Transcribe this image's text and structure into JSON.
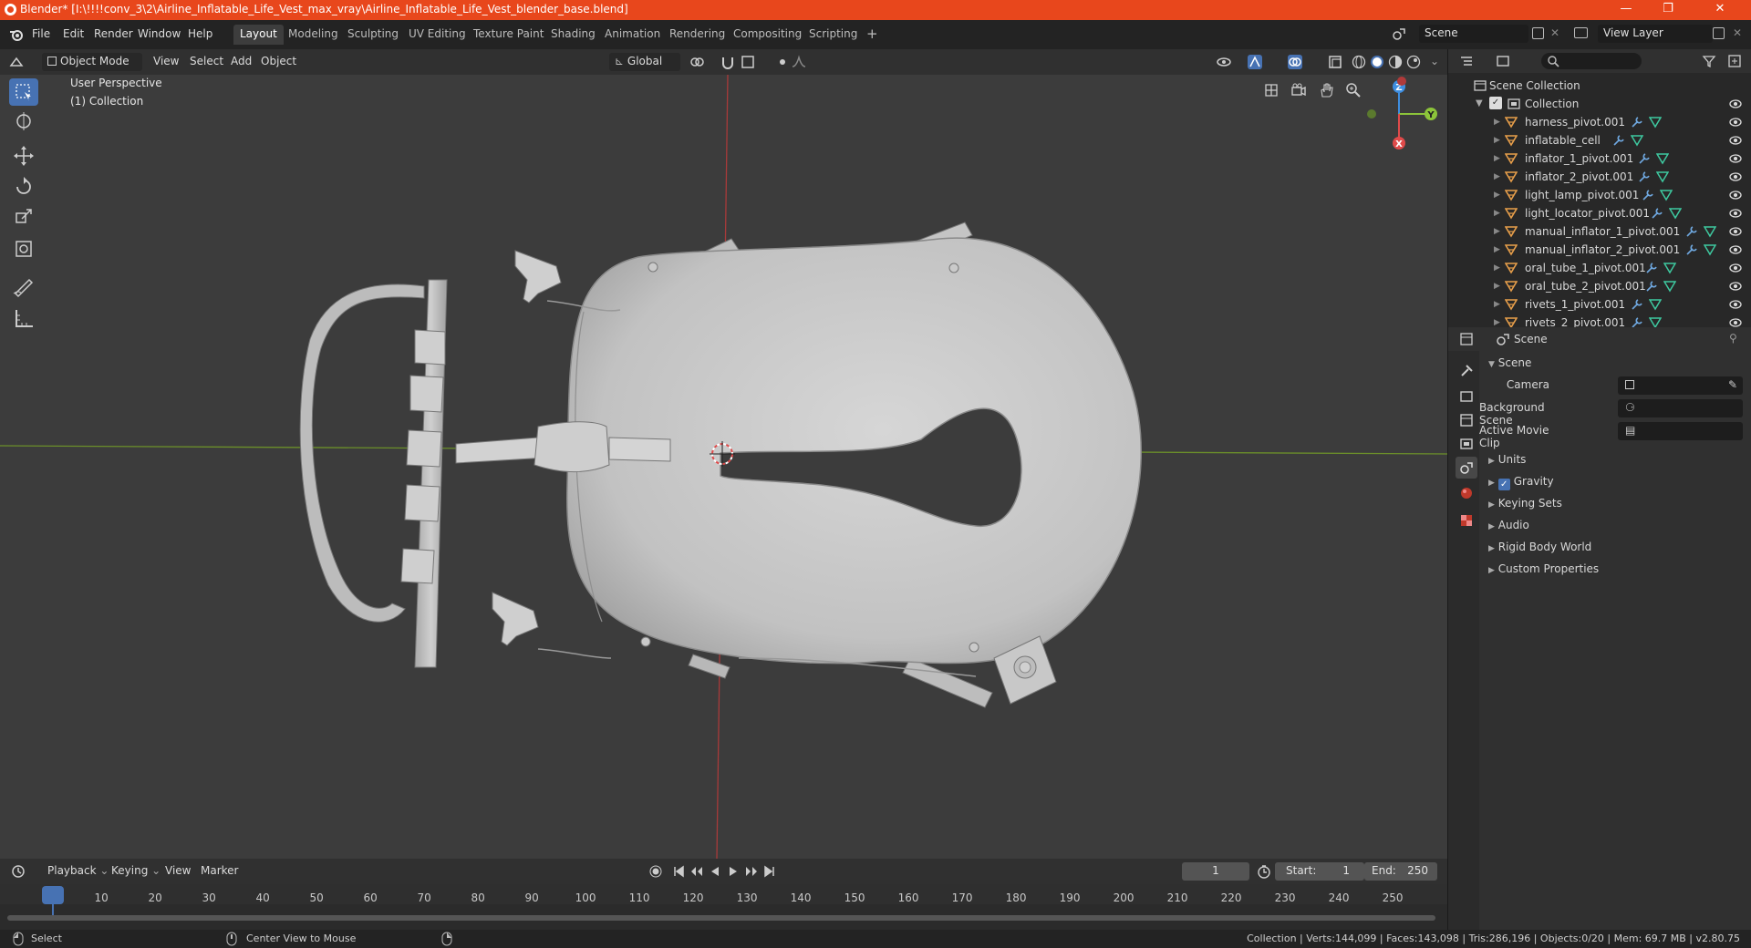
{
  "window": {
    "title": "Blender* [I:\\!!!!conv_3\\2\\Airline_Inflatable_Life_Vest_max_vray\\Airline_Inflatable_Life_Vest_blender_base.blend]",
    "minimize": "—",
    "maximize": "❐",
    "close": "✕"
  },
  "menubar": [
    "File",
    "Edit",
    "Render",
    "Window",
    "Help"
  ],
  "workspaces": [
    "Layout",
    "Modeling",
    "Sculpting",
    "UV Editing",
    "Texture Paint",
    "Shading",
    "Animation",
    "Rendering",
    "Compositing",
    "Scripting",
    "+"
  ],
  "scene_field": "Scene",
  "view_layer_field": "View Layer",
  "viewport_header": {
    "mode": "Object Mode",
    "menus": [
      "View",
      "Select",
      "Add",
      "Object"
    ],
    "transform_orientation": "Global"
  },
  "viewport": {
    "perspective": "User Perspective",
    "collection": "(1) Collection",
    "gizmo": {
      "x": "X",
      "y": "Y",
      "z": "Z"
    }
  },
  "outliner": {
    "root": "Scene Collection",
    "collection": "Collection",
    "items": [
      "harness_pivot.001",
      "inflatable_cell",
      "inflator_1_pivot.001",
      "inflator_2_pivot.001",
      "light_lamp_pivot.001",
      "light_locator_pivot.001",
      "manual_inflator_1_pivot.001",
      "manual_inflator_2_pivot.001",
      "oral_tube_1_pivot.001",
      "oral_tube_2_pivot.001",
      "rivets_1_pivot.001",
      "rivets_2_pivot.001"
    ]
  },
  "properties": {
    "header": "Scene",
    "panel": "Scene",
    "camera_label": "Camera",
    "background_scene_label": "Background Scene",
    "active_movie_clip_label": "Active Movie Clip",
    "sections": [
      "Units",
      "Gravity",
      "Keying Sets",
      "Audio",
      "Rigid Body World",
      "Custom Properties"
    ],
    "gravity_checked": true
  },
  "timeline": {
    "menus": [
      "Playback",
      "Keying",
      "View",
      "Marker"
    ],
    "current_frame": "1",
    "start_label": "Start:",
    "start": "1",
    "end_label": "End:",
    "end": "250",
    "ruler": [
      "1",
      "10",
      "20",
      "30",
      "40",
      "50",
      "60",
      "70",
      "80",
      "90",
      "100",
      "110",
      "120",
      "130",
      "140",
      "150",
      "160",
      "170",
      "180",
      "190",
      "200",
      "210",
      "220",
      "230",
      "240",
      "250"
    ]
  },
  "statusbar": {
    "left": "Select",
    "middle": "Center View to Mouse",
    "right": "Collection | Verts:144,099 | Faces:143,098 | Tris:286,196 | Objects:0/20 | Mem: 69.7 MB | v2.80.75"
  },
  "colors": {
    "title_bar": "#e8471c",
    "accent": "#4772b3",
    "x_axis": "#e04a4a",
    "y_axis": "#8cc43a",
    "z_axis": "#3e8ee0",
    "object_icon": "#e89f4a"
  }
}
